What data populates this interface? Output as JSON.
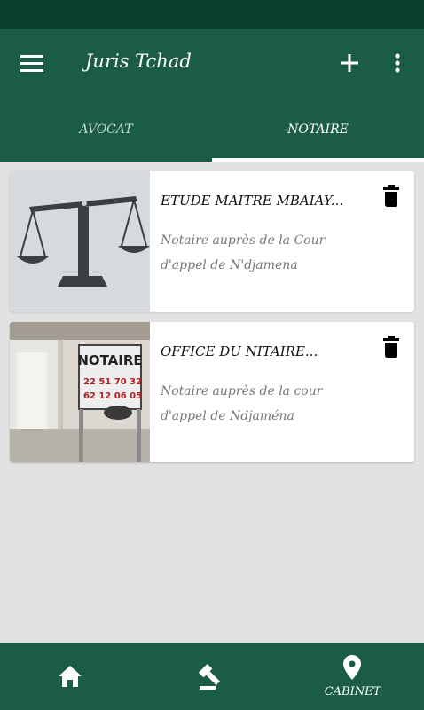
{
  "app_bar": {
    "title": "Juris Tchad",
    "menu_icon": "menu-icon",
    "add_icon": "add-icon",
    "more_icon": "more-vert-icon"
  },
  "tabs": [
    {
      "label": "AVOCAT",
      "selected": false
    },
    {
      "label": "NOTAIRE",
      "selected": true
    }
  ],
  "cards": [
    {
      "title": "ETUDE MAITRE MBAIAY...",
      "description": "Notaire auprès de la Cour d'appel de N'djamena",
      "thumbnail": "scales-of-justice-image",
      "delete_icon": "delete-icon"
    },
    {
      "title": "OFFICE DU NITAIRE...",
      "description": "Notaire auprès de la cour d'appel de Ndjaména",
      "thumbnail": "notaire-sign-photo",
      "sign_text": "NOTAIRE",
      "sign_phone_1": "22 51 70 32",
      "sign_phone_2": "62 12 06 05",
      "delete_icon": "delete-icon"
    }
  ],
  "bottom_nav": [
    {
      "icon": "home-icon",
      "label": ""
    },
    {
      "icon": "gavel-icon",
      "label": ""
    },
    {
      "icon": "location-pin-icon",
      "label": "CABINET"
    }
  ],
  "colors": {
    "status_bar": "#0d3f2e",
    "primary": "#1a5c46",
    "background": "#e2e2e2",
    "card": "#ffffff"
  }
}
